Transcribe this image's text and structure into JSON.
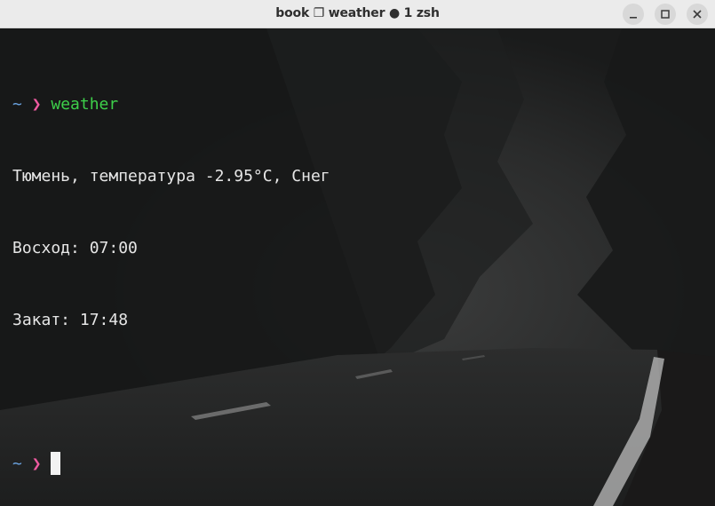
{
  "window": {
    "title": "book ❐ weather ● 1 zsh"
  },
  "terminal": {
    "prompt_tilde": "~",
    "prompt_chevron": "❯",
    "command": "weather",
    "output": [
      "Тюмень, температура -2.95°C, Снег",
      "Восход: 07:00",
      "Закат: 17:48"
    ]
  },
  "icons": {
    "minimize": "minimize-icon",
    "maximize": "maximize-icon",
    "close": "close-icon"
  },
  "colors": {
    "tilde": "#6aa3e0",
    "chevron": "#ef5aa0",
    "command": "#3dcf4a",
    "text": "#e6e6e6",
    "titlebar": "#ebebeb"
  }
}
